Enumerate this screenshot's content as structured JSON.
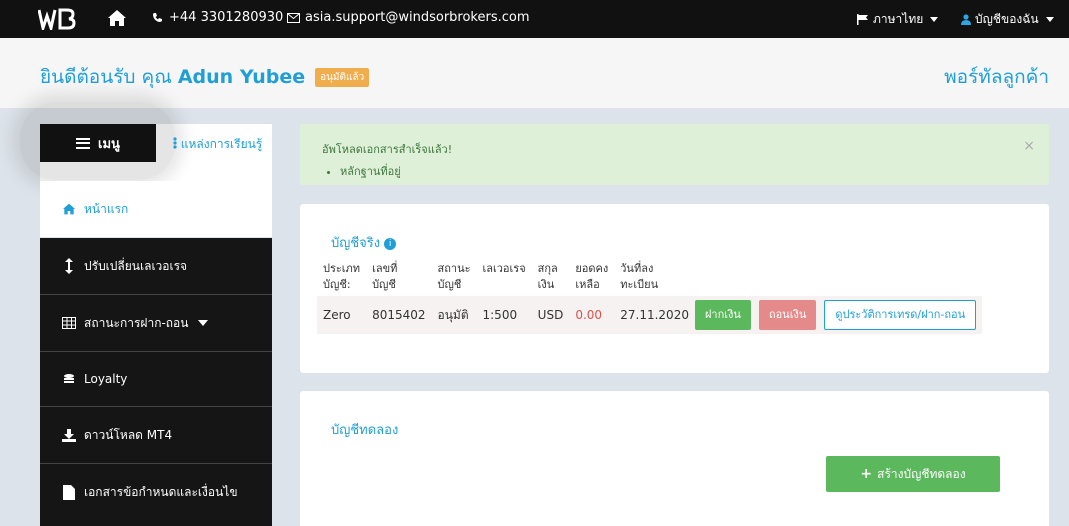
{
  "topbar": {
    "logo_text": "WB",
    "phone": "+44 3301280930",
    "email": "asia.support@windsorbrokers.com",
    "language": "ภาษาไทย",
    "account": "บัญชีของฉัน"
  },
  "welcome": {
    "greeting": "ยินดีต้อนรับ คุณ",
    "name": "Adun Yubee",
    "status_badge": "อนุมัติแล้ว",
    "portal_link": "พอร์ทัลลูกค้า"
  },
  "sidebar": {
    "menu_label": "เมนู",
    "learn_link": "แหล่งการเรียนรู้",
    "items": [
      {
        "label": "หน้าแรก",
        "icon": "home-icon"
      },
      {
        "label": "ปรับเปลี่ยนเลเวอเรจ",
        "icon": "arrows-vertical-icon"
      },
      {
        "label": "สถานะการฝาก-ถอน",
        "icon": "table-icon"
      },
      {
        "label": "Loyalty",
        "icon": "coins-icon"
      },
      {
        "label": "ดาวน์โหลด MT4",
        "icon": "download-icon"
      },
      {
        "label": "เอกสารข้อกำหนดและเงื่อนไข",
        "icon": "document-icon"
      }
    ]
  },
  "alert": {
    "title": "อัพโหลดเอกสารสำเร็จแล้ว!",
    "items": [
      "หลักฐานที่อยู่"
    ],
    "close": "×"
  },
  "real_accounts": {
    "title": "บัญชีจริง",
    "info": "i",
    "headers": [
      [
        "ประเภท",
        "บัญชี:"
      ],
      [
        "เลขที่",
        "บัญชี"
      ],
      [
        "สถานะ",
        "บัญชี"
      ],
      [
        "เลเวอเรจ",
        ""
      ],
      [
        "สกุล",
        "เงิน"
      ],
      [
        "ยอดคง",
        "เหลือ"
      ],
      [
        "วันที่ลง",
        "ทะเบียน"
      ]
    ],
    "row": {
      "type": "Zero",
      "number": "8015402",
      "status": "อนุมัติ",
      "leverage": "1:500",
      "currency": "USD",
      "balance": "0.00",
      "registered": "27.11.2020"
    },
    "deposit_btn": "ฝากเงิน",
    "withdraw_btn": "ถอนเงิน",
    "history_btn": "ดูประวัติการเทรด/ฝาก-ถอน"
  },
  "demo_accounts": {
    "title": "บัญชีทดลอง",
    "create_btn": "สร้างบัญชีทดลอง"
  },
  "colors": {
    "accent": "#1f9fd6",
    "topbar": "#111111",
    "success_bg": "#dff0d8",
    "green": "#5cb85c",
    "badge": "#f0ad4e"
  }
}
